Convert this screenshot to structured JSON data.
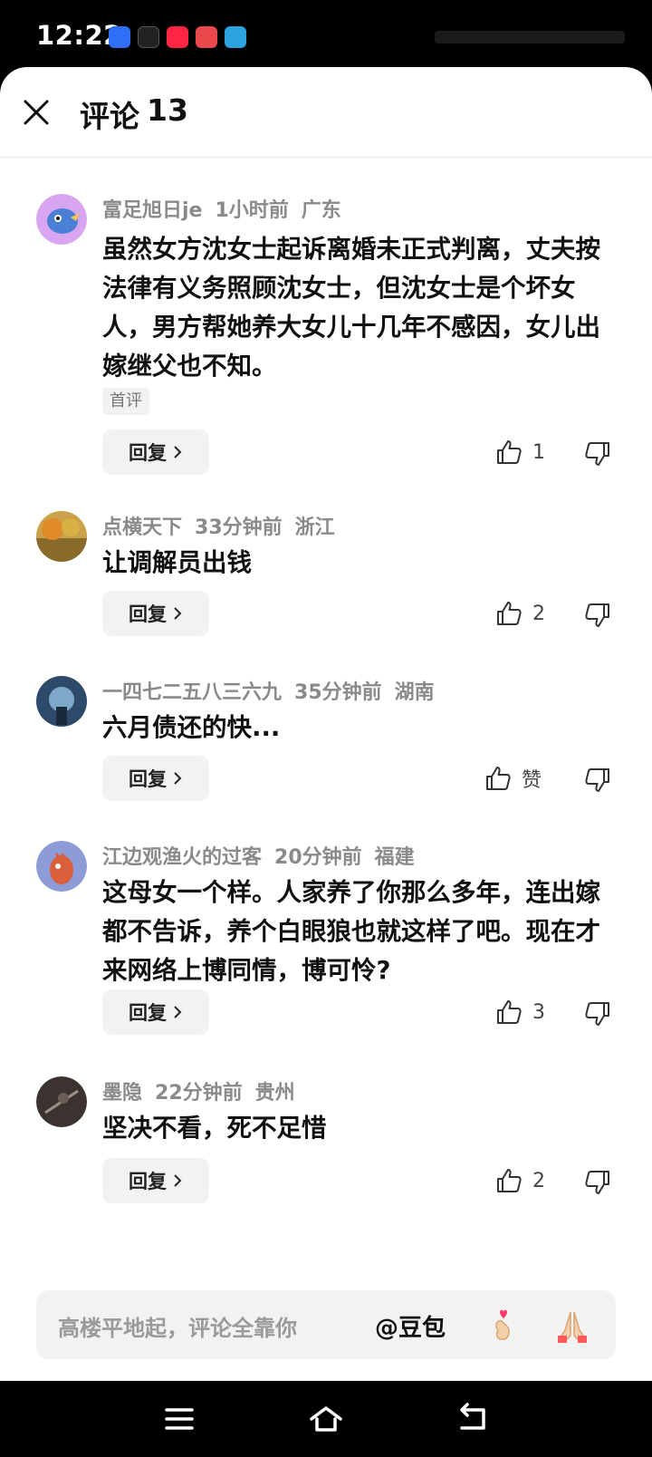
{
  "status_bar": {
    "time": "12:22",
    "apps": [
      {
        "name": "baidu-app-icon",
        "color": "#2f6ef6"
      },
      {
        "name": "douyin-app-icon",
        "color": "#111111"
      },
      {
        "name": "xiaohongshu-app-icon",
        "color": "#ff2442"
      },
      {
        "name": "game-app-icon",
        "color": "#e9484c"
      },
      {
        "name": "telegram-app-icon",
        "color": "#2aa3df"
      }
    ]
  },
  "header": {
    "title": "评论",
    "count": "13"
  },
  "comments": [
    {
      "user": "富足旭日je",
      "time": "1小时前",
      "location": "广东",
      "text": "虽然女方沈女士起诉离婚未正式判离，丈夫按法律有义务照顾沈女士，但沈女士是个坏女人，男方帮她养大女儿十几年不感因，女儿出嫁继父也不知。",
      "tag": "首评",
      "reply_label": "回复",
      "likes": "1"
    },
    {
      "user": "点横天下",
      "time": "33分钟前",
      "location": "浙江",
      "text": "让调解员出钱",
      "reply_label": "回复",
      "likes": "2"
    },
    {
      "user": "一四七二五八三六九",
      "time": "35分钟前",
      "location": "湖南",
      "text": "六月债还的快...",
      "reply_label": "回复",
      "likes": "赞"
    },
    {
      "user": "江边观渔火的过客",
      "time": "20分钟前",
      "location": "福建",
      "text": "这母女一个样。人家养了你那么多年，连出嫁都不告诉，养个白眼狼也就这样了吧。现在才来网络上博同情，博可怜?",
      "reply_label": "回复",
      "likes": "3"
    },
    {
      "user": "墨隐",
      "time": "22分钟前",
      "location": "贵州",
      "text": "坚决不看，死不足惜",
      "reply_label": "回复",
      "likes": "2"
    }
  ],
  "input_bar": {
    "placeholder": "高楼平地起，评论全靠你",
    "mention": "@豆包"
  },
  "colors": {
    "background": "#ffffff",
    "text": "#111111",
    "meta": "#8a8a8a",
    "button_bg": "#f2f2f2"
  }
}
